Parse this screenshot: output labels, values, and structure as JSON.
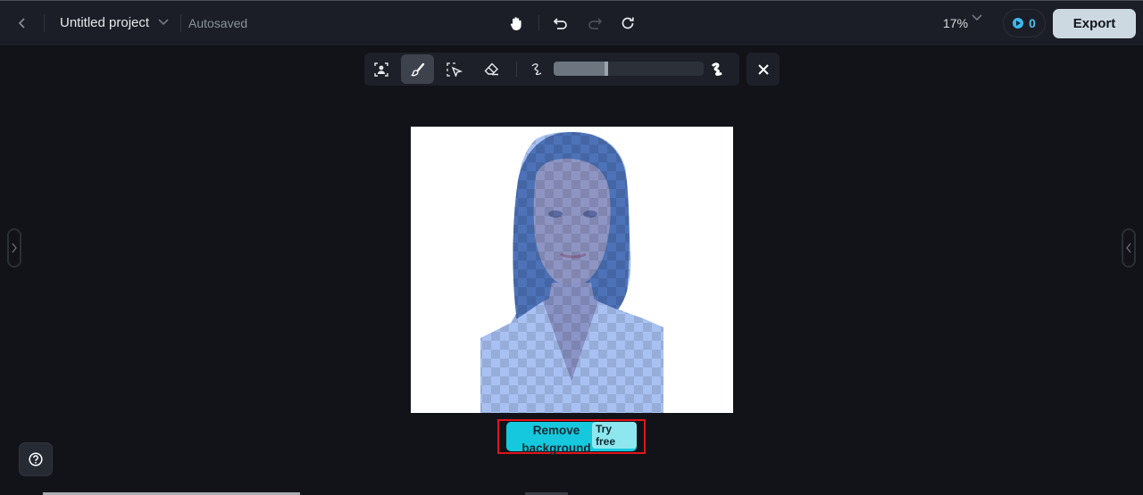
{
  "header": {
    "back_icon": "chevron-left-icon",
    "project_title": "Untitled project",
    "title_menu_icon": "chevron-down-icon",
    "save_status": "Autosaved",
    "center_tools": [
      {
        "name": "hand-tool",
        "icon": "hand-icon",
        "enabled": true
      },
      {
        "name": "undo",
        "icon": "undo-icon",
        "enabled": true
      },
      {
        "name": "redo",
        "icon": "redo-icon",
        "enabled": false
      },
      {
        "name": "refresh",
        "icon": "refresh-icon",
        "enabled": true
      }
    ],
    "zoom_level": "17%",
    "credits": "0",
    "export_label": "Export"
  },
  "toolbar": {
    "tools": [
      {
        "name": "subject-select",
        "icon": "person-select-icon",
        "active": false
      },
      {
        "name": "brush",
        "icon": "brush-icon",
        "active": true
      },
      {
        "name": "area-select",
        "icon": "area-select-icon",
        "active": false
      },
      {
        "name": "eraser",
        "icon": "eraser-icon",
        "active": false
      }
    ],
    "brush_size": {
      "min_icon": "thin-stroke-icon",
      "max_icon": "thick-stroke-icon",
      "value_fraction": 0.35
    },
    "close_icon": "close-icon"
  },
  "canvas": {
    "image_description": "Portrait of a woman with brush mask overlay (blue checkerboard)",
    "mask_color": "#4f7ed6"
  },
  "remove_background": {
    "label": "Remove background",
    "badge": "Try free",
    "credit_cost": "0",
    "button_color": "#16c8dd",
    "highlight_color": "#e0141c"
  },
  "side_panels": {
    "left_toggle_icon": "chevron-right-icon",
    "right_toggle_icon": "chevron-left-icon"
  },
  "help": {
    "icon": "help-circle-icon"
  }
}
